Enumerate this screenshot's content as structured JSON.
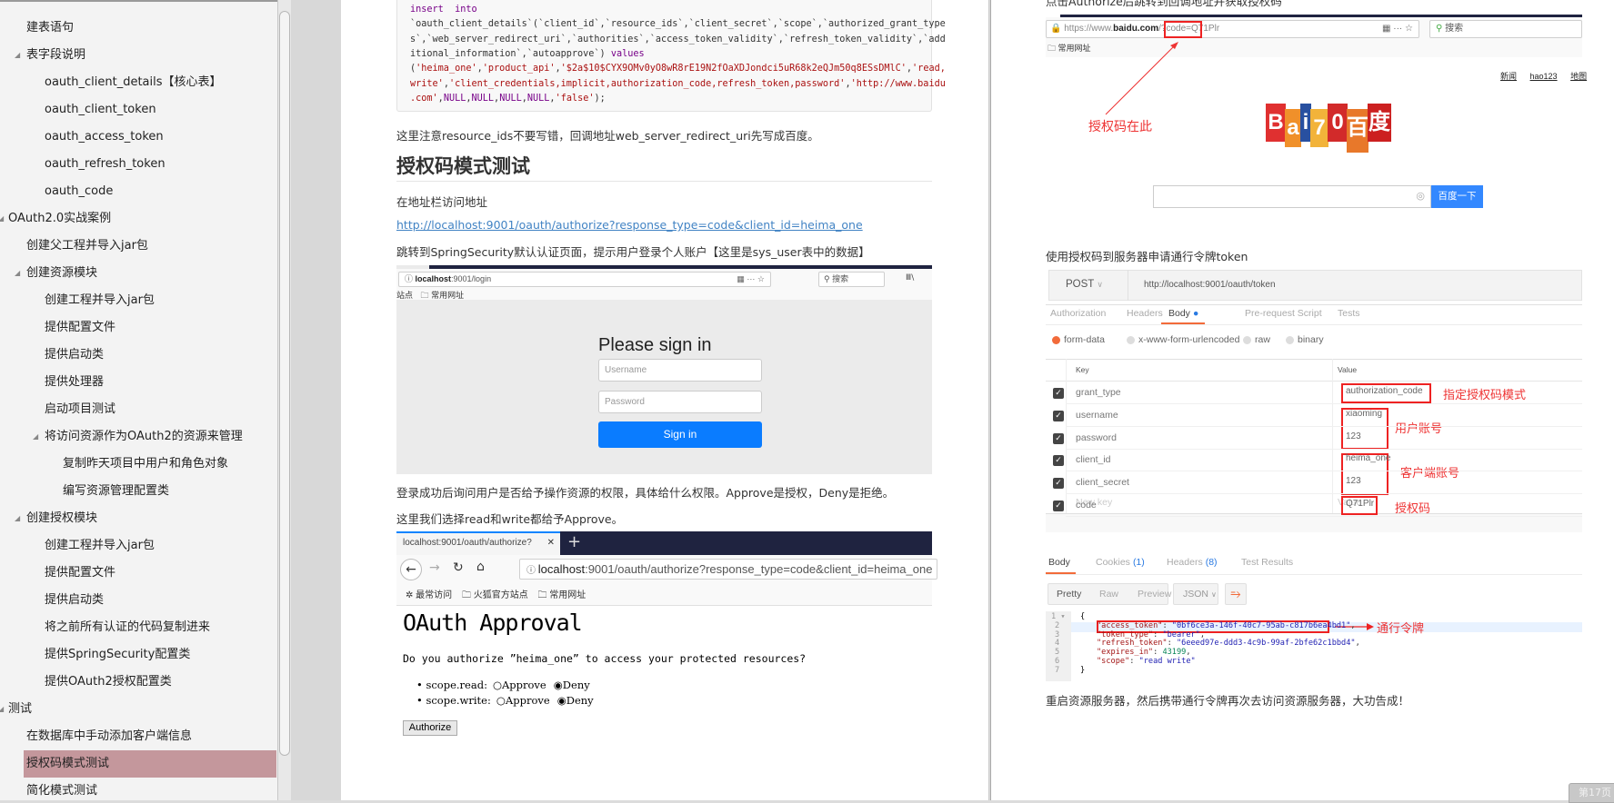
{
  "sidebar": {
    "items": [
      {
        "label": "建表语句",
        "level": 1
      },
      {
        "label": "表字段说明",
        "level": 1,
        "expanded": true
      },
      {
        "label": "oauth_client_details【核心表】",
        "level": 2
      },
      {
        "label": "oauth_client_token",
        "level": 2
      },
      {
        "label": "oauth_access_token",
        "level": 2
      },
      {
        "label": "oauth_refresh_token",
        "level": 2
      },
      {
        "label": "oauth_code",
        "level": 2
      },
      {
        "label": "OAuth2.0实战案例",
        "level": 0,
        "expanded": true
      },
      {
        "label": "创建父工程并导入jar包",
        "level": 1
      },
      {
        "label": "创建资源模块",
        "level": 1,
        "expanded": true
      },
      {
        "label": "创建工程并导入jar包",
        "level": 2
      },
      {
        "label": "提供配置文件",
        "level": 2
      },
      {
        "label": "提供启动类",
        "level": 2
      },
      {
        "label": "提供处理器",
        "level": 2
      },
      {
        "label": "启动项目测试",
        "level": 2
      },
      {
        "label": "将访问资源作为OAuth2的资源来管理",
        "level": 2,
        "expanded": true
      },
      {
        "label": "复制昨天项目中用户和角色对象",
        "level": 3
      },
      {
        "label": "编写资源管理配置类",
        "level": 3
      },
      {
        "label": "创建授权模块",
        "level": 1,
        "expanded": true
      },
      {
        "label": "创建工程并导入jar包",
        "level": 2
      },
      {
        "label": "提供配置文件",
        "level": 2
      },
      {
        "label": "提供启动类",
        "level": 2
      },
      {
        "label": "将之前所有认证的代码复制进来",
        "level": 2
      },
      {
        "label": "提供SpringSecurity配置类",
        "level": 2
      },
      {
        "label": "提供OAuth2授权配置类",
        "level": 2
      },
      {
        "label": "测试",
        "level": 0,
        "expanded": true
      },
      {
        "label": "在数据库中手动添加客户端信息",
        "level": 1
      },
      {
        "label": "授权码模式测试",
        "level": 1,
        "active": true
      },
      {
        "label": "简化模式测试",
        "level": 1
      }
    ],
    "active_color": "#c4979c"
  },
  "left_page": {
    "code_lines": [
      [
        {
          "t": "insert  into",
          "c": "kw"
        }
      ],
      [
        {
          "t": "`oauth_client_details`(`client_id`,`resource_ids`,`client_secret`,`scope`,`authorized_grant_type",
          "c": ""
        }
      ],
      [
        {
          "t": "s`,`web_server_redirect_uri`,`authorities`,`access_token_validity`,`refresh_token_validity`,`add",
          "c": ""
        }
      ],
      [
        {
          "t": "itional_information`,`autoapprove`) ",
          "c": ""
        },
        {
          "t": "values",
          "c": "kw"
        }
      ],
      [
        {
          "t": "(",
          "c": ""
        },
        {
          "t": "'heima_one'",
          "c": "str"
        },
        {
          "t": ",",
          "c": ""
        },
        {
          "t": "'product_api'",
          "c": "str"
        },
        {
          "t": ",",
          "c": ""
        },
        {
          "t": "'$2a$10$CYX9OMv0yO8wR8rE19N2fOaXDJondci5uR68k2eQJm50q8ESsDMlC'",
          "c": "str"
        },
        {
          "t": ",",
          "c": ""
        },
        {
          "t": "'read,",
          "c": "str"
        }
      ],
      [
        {
          "t": "write'",
          "c": "str"
        },
        {
          "t": ",",
          "c": ""
        },
        {
          "t": "'client_credentials,implicit,authorization_code,refresh_token,password'",
          "c": "str"
        },
        {
          "t": ",",
          "c": ""
        },
        {
          "t": "'http://www.baidu",
          "c": "str"
        }
      ],
      [
        {
          "t": ".com'",
          "c": "str"
        },
        {
          "t": ",",
          "c": ""
        },
        {
          "t": "NULL",
          "c": "kw"
        },
        {
          "t": ",",
          "c": ""
        },
        {
          "t": "NULL",
          "c": "kw"
        },
        {
          "t": ",",
          "c": ""
        },
        {
          "t": "NULL",
          "c": "kw"
        },
        {
          "t": ",",
          "c": ""
        },
        {
          "t": "NULL",
          "c": "kw"
        },
        {
          "t": ",",
          "c": ""
        },
        {
          "t": "'false'",
          "c": "str"
        },
        {
          "t": ");",
          "c": ""
        }
      ]
    ],
    "note": "这里注意resource_ids不要写错，回调地址web_server_redirect_uri先写成百度。",
    "heading": "授权码模式测试",
    "visit_text": "在地址栏访问地址",
    "authorize_link": "http://localhost:9001/oauth/authorize?response_type=code&client_id=heima_one",
    "redirect_text": "跳转到SpringSecurity默认认证页面，提示用户登录个人账户【这里是sys_user表中的数据】",
    "login_shot": {
      "url_host": "localhost",
      "url_rest": ":9001/login",
      "search_placeholder": "搜索",
      "bookmark_prefix": "站点",
      "bookmark_folder": "常用网址",
      "title": "Please sign in",
      "username_placeholder": "Username",
      "password_placeholder": "Password",
      "signin_label": "Sign in"
    },
    "after_login_text": "登录成功后询问用户是否给予操作资源的权限，具体给什么权限。Approve是授权，Deny是拒绝。",
    "choose_text": "这里我们选择read和write都给予Approve。",
    "approval_shot": {
      "tab_title": "localhost:9001/oauth/authorize?",
      "url_host": "localhost",
      "url_rest": ":9001/oauth/authorize?response_type=code&client_id=heima_one",
      "bookmarks": [
        "最常访问",
        "火狐官方站点",
        "常用网址"
      ],
      "title": "OAuth Approval",
      "question": "Do you authorize ”heima_one” to access your protected resources?",
      "scopes": [
        {
          "name": "scope.read:",
          "approve": "Approve",
          "deny": "Deny",
          "selected": "deny"
        },
        {
          "name": "scope.write:",
          "approve": "Approve",
          "deny": "Deny",
          "selected": "deny"
        }
      ],
      "authorize_label": "Authorize"
    }
  },
  "right_page": {
    "top_text": "点击Authorize后跳转到回调地址并获取授权码",
    "baidu_shot": {
      "url_prefix": "https://www.",
      "url_host": "baidu.com",
      "url_path": "/?code=",
      "code": "Q71Plr",
      "search_placeholder": "搜索",
      "bookmark_folder": "常用网址",
      "top_links": [
        "新闻",
        "hao123",
        "地图"
      ],
      "logo_text": [
        "B",
        "a",
        "i",
        "7",
        "0",
        "百",
        "度"
      ],
      "search_button": "百度一下",
      "annotation": "授权码在此"
    },
    "token_text": "使用授权码到服务器申请通行令牌token",
    "postman": {
      "method": "POST",
      "url": "http://localhost:9001/oauth/token",
      "request_tabs": [
        "Authorization",
        "Headers",
        "Body",
        "Pre-request Script",
        "Tests"
      ],
      "active_request_tab": "Body",
      "body_types": [
        "form-data",
        "x-www-form-urlencoded",
        "raw",
        "binary"
      ],
      "active_body_type": "form-data",
      "table_headers": [
        "Key",
        "Value"
      ],
      "rows": [
        {
          "key": "grant_type",
          "value": "authorization_code",
          "checked": true
        },
        {
          "key": "username",
          "value": "xiaoming",
          "checked": true
        },
        {
          "key": "password",
          "value": "123",
          "checked": true
        },
        {
          "key": "client_id",
          "value": "heima_one",
          "checked": true
        },
        {
          "key": "client_secret",
          "value": "123",
          "checked": true
        },
        {
          "key": "code",
          "value": "Q71Plr",
          "checked": true
        }
      ],
      "new_key_placeholder": "New key",
      "new_value_placeholder": "Value",
      "annotations": [
        "指定授权码模式",
        "用户账号",
        "客户端账号",
        "授权码",
        "通行令牌"
      ],
      "response_tabs": [
        {
          "label": "Body"
        },
        {
          "label": "Cookies",
          "count": "(1)"
        },
        {
          "label": "Headers",
          "count": "(8)"
        },
        {
          "label": "Test Results"
        }
      ],
      "view_modes": [
        "Pretty",
        "Raw",
        "Preview"
      ],
      "format": "JSON",
      "response_json": {
        "access_token": "0bf6ce3a-146f-40c7-95ab-c817b6ea4bd1",
        "token_type": "bearer",
        "refresh_token": "6eeed97e-ddd3-4c9b-99af-2bfe62c1bbd4",
        "expires_in": "43199",
        "scope": "read write"
      }
    },
    "final_text": "重启资源服务器，然后携带通行令牌再次去访问资源服务器，大功告成！"
  },
  "page_indicator": "第17页",
  "colors": {
    "accent_orange": "#f26b3a",
    "link_blue": "#4183c4",
    "annotation_red": "#e22222",
    "signin_blue": "#0a7cff",
    "baidu_blue": "#3388ff"
  }
}
